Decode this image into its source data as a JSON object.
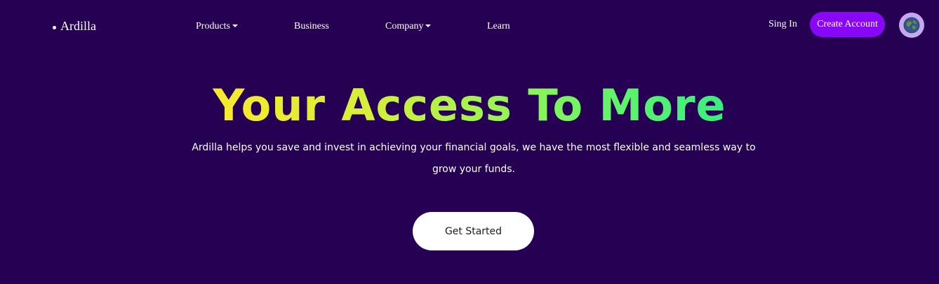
{
  "nav": {
    "logo_text": "Ardilla",
    "items": [
      {
        "label": "Products",
        "has_dropdown": true
      },
      {
        "label": "Business",
        "has_dropdown": false
      },
      {
        "label": "Company",
        "has_dropdown": true
      },
      {
        "label": "Learn",
        "has_dropdown": false
      }
    ],
    "signin_label": "Sing In",
    "create_account_label": "Create Account",
    "avatar_icon": "globe-icon"
  },
  "hero": {
    "title": "Your Access To More",
    "description": "Ardilla helps you save and invest in achieving your financial goals, we have the most flexible and seamless way to grow your funds.",
    "cta_label": "Get Started"
  },
  "colors": {
    "background": "#260052",
    "accent": "#8807f7",
    "title_gradient_start": "#f9e92c",
    "title_gradient_end": "#37ee80"
  }
}
